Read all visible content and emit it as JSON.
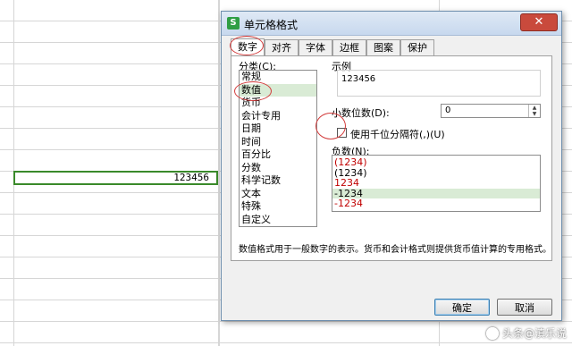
{
  "sheet": {
    "cell_value": "123456"
  },
  "dialog": {
    "title": "单元格格式",
    "app_icon_letter": "S",
    "close_label": "✕",
    "tabs": [
      "数字",
      "对齐",
      "字体",
      "边框",
      "图案",
      "保护"
    ],
    "active_tab": "数字",
    "category_label": "分类(C):",
    "categories": [
      "常规",
      "数值",
      "货币",
      "会计专用",
      "日期",
      "时间",
      "百分比",
      "分数",
      "科学记数",
      "文本",
      "特殊",
      "自定义"
    ],
    "selected_category": "数值",
    "sample_label": "示例",
    "sample_value": "123456",
    "decimal_label": "小数位数(D):",
    "decimal_value": "0",
    "thousands_label": "使用千位分隔符(,)(U)",
    "negative_label": "负数(N):",
    "negative_options": [
      {
        "text": "(1234)",
        "red": true
      },
      {
        "text": "(1234)",
        "red": false
      },
      {
        "text": "1234",
        "red": true
      },
      {
        "text": "-1234",
        "red": false,
        "selected": true
      },
      {
        "text": "-1234",
        "red": true
      }
    ],
    "description": "数值格式用于一般数字的表示。货币和会计格式则提供货币值计算的专用格式。",
    "ok_label": "确定",
    "cancel_label": "取消",
    "colors": {
      "selection": "#d9ebd5",
      "negative_red": "#c00000",
      "annotation_ring": "#d23b3b"
    }
  },
  "watermark": {
    "text": "头条@滇乐说"
  }
}
